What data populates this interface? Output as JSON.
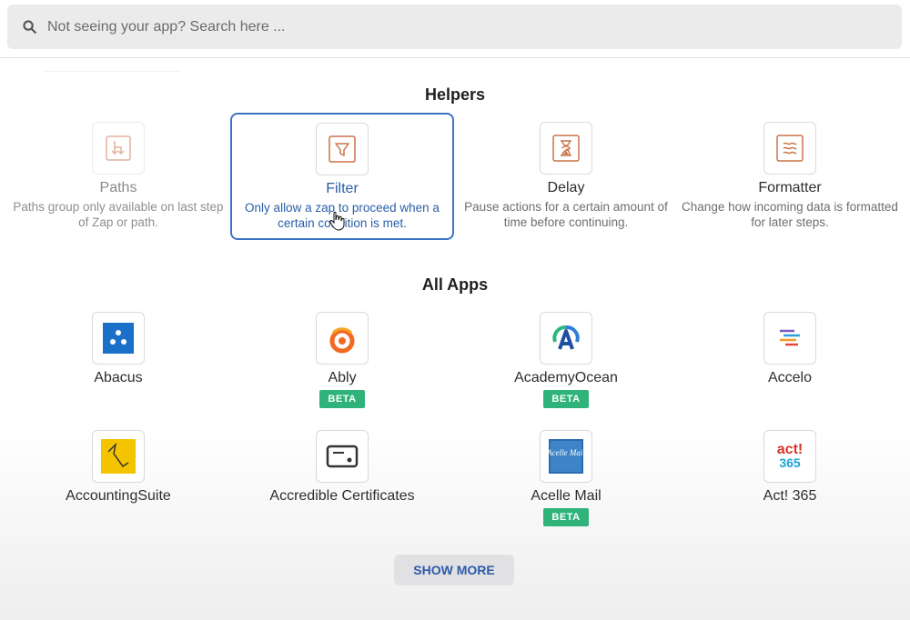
{
  "search": {
    "placeholder": "Not seeing your app? Search here ..."
  },
  "helpers": {
    "title": "Helpers",
    "items": [
      {
        "name": "Paths",
        "description": "Paths group only available on last step of Zap or path.",
        "icon": "paths-icon",
        "state": "disabled"
      },
      {
        "name": "Filter",
        "description": "Only allow a zap to proceed when a certain condition is met.",
        "icon": "filter-icon",
        "state": "selected"
      },
      {
        "name": "Delay",
        "description": "Pause actions for a certain amount of time before continuing.",
        "icon": "hourglass-icon",
        "state": "normal"
      },
      {
        "name": "Formatter",
        "description": "Change how incoming data is formatted for later steps.",
        "icon": "formatter-icon",
        "state": "normal"
      }
    ]
  },
  "apps": {
    "title": "All Apps",
    "beta_label": "BETA",
    "items": [
      {
        "name": "Abacus",
        "beta": false,
        "icon": "abacus-logo"
      },
      {
        "name": "Ably",
        "beta": true,
        "icon": "ably-logo"
      },
      {
        "name": "AcademyOcean",
        "beta": true,
        "icon": "academyocean-logo"
      },
      {
        "name": "Accelo",
        "beta": false,
        "icon": "accelo-logo"
      },
      {
        "name": "AccountingSuite",
        "beta": false,
        "icon": "accountingsuite-logo"
      },
      {
        "name": "Accredible Certificates",
        "beta": false,
        "icon": "accredible-logo"
      },
      {
        "name": "Acelle Mail",
        "beta": true,
        "icon": "acelle-mail-logo",
        "logo_text": "Acelle Mail"
      },
      {
        "name": "Act! 365",
        "beta": false,
        "icon": "act365-logo",
        "logo_text_top": "act!",
        "logo_text_bottom": "365"
      }
    ]
  },
  "show_more_label": "SHOW MORE",
  "colors": {
    "accent": "#3d73c4",
    "beta": "#2fb37a",
    "helper_icon": "#c8744a",
    "abacus": "#1a6fc9"
  }
}
